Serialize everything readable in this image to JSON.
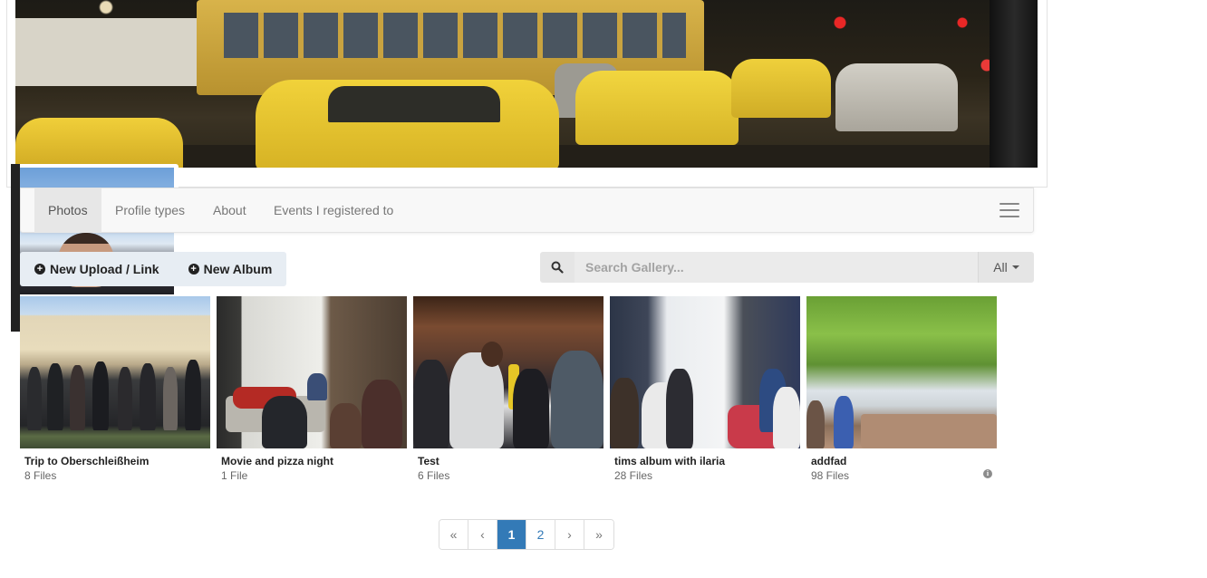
{
  "nav": {
    "tabs": [
      {
        "label": "Photos",
        "active": true
      },
      {
        "label": "Profile types",
        "active": false
      },
      {
        "label": "About",
        "active": false
      },
      {
        "label": "Events I registered to",
        "active": false
      }
    ],
    "menu_icon": "hamburger-menu-icon"
  },
  "actions": {
    "new_upload_label": "New Upload / Link",
    "new_album_label": "New Album",
    "icon": "plus-circle-icon"
  },
  "search": {
    "placeholder": "Search Gallery...",
    "value": "",
    "icon": "search-icon",
    "filter_selected": "All"
  },
  "albums": [
    {
      "title": "Trip to Oberschleißheim",
      "count": "8 Files"
    },
    {
      "title": "Movie and pizza night",
      "count": "1 File"
    },
    {
      "title": "Test",
      "count": "6 Files"
    },
    {
      "title": "tims album with ilaria",
      "count": "28 Files"
    },
    {
      "title": "addfad",
      "count": "98 Files",
      "info_icon": "i"
    }
  ],
  "pagination": {
    "first": "«",
    "prev": "‹",
    "pages": [
      "1",
      "2"
    ],
    "current": "1",
    "next": "›",
    "last": "»"
  },
  "colors": {
    "accent": "#337ab7",
    "nav_active_bg": "#e7e7e7",
    "button_group_bg": "#e7edf3"
  }
}
